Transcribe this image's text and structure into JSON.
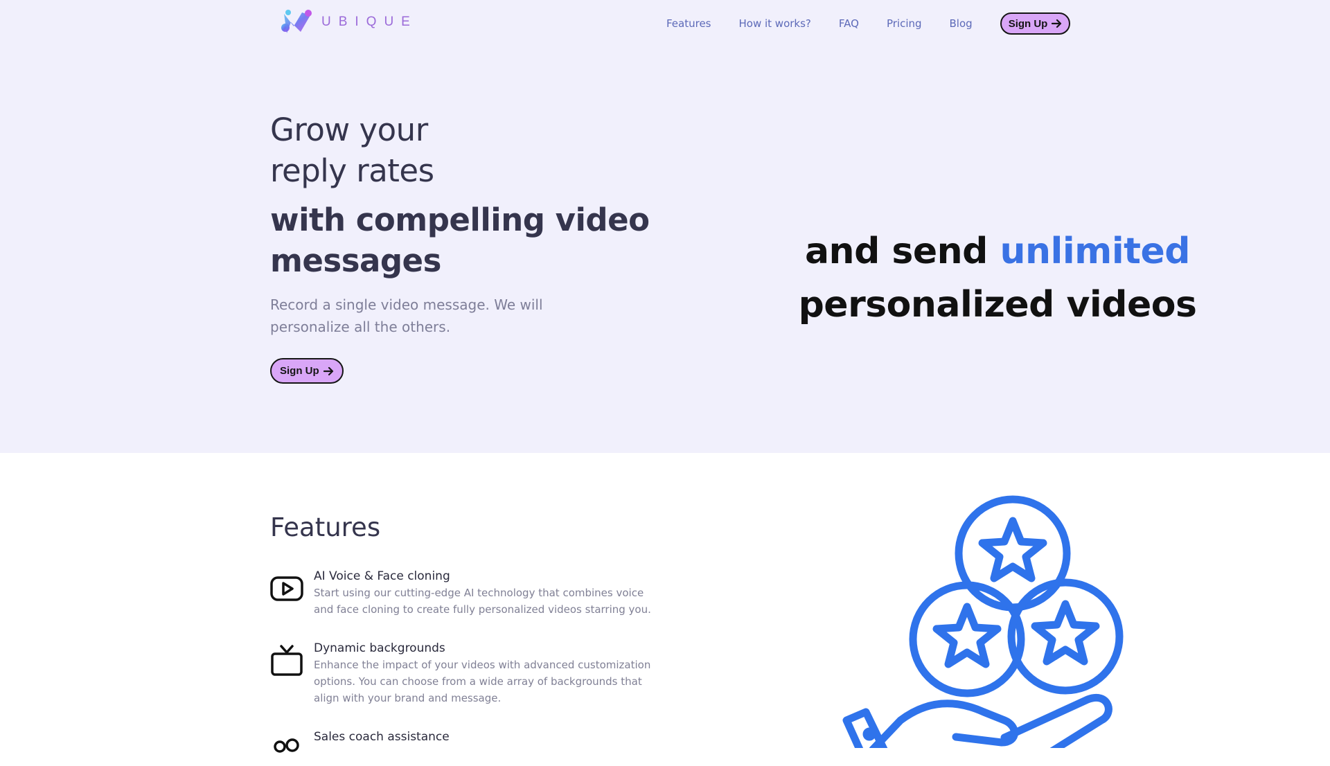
{
  "brand": {
    "name": "UBIQUE"
  },
  "nav": {
    "items": [
      "Features",
      "How it works?",
      "FAQ",
      "Pricing",
      "Blog"
    ],
    "signup_label": "Sign Up"
  },
  "hero": {
    "headline_line1": "Grow your",
    "headline_line2": "reply rates",
    "headline_rest": "with compelling video messages",
    "subtitle": "Record a single video message. We will personalize all the others.",
    "cta_label": "Sign Up",
    "tagline_before": "and send ",
    "tagline_highlight": "unlimited",
    "tagline_after": " personalized videos"
  },
  "features": {
    "title": "Features",
    "items": [
      {
        "icon": "youtube-play-icon",
        "title": "AI Voice & Face cloning",
        "description": "Start using our cutting-edge AI technology that combines voice and face cloning to create fully personalized videos starring you."
      },
      {
        "icon": "tv-icon",
        "title": "Dynamic backgrounds",
        "description": "Enhance the impact of your videos with advanced customization options. You can choose from a wide array of backgrounds that align with your brand and message."
      },
      {
        "icon": "users-icon",
        "title": "Sales coach assistance",
        "description": ""
      }
    ]
  },
  "colors": {
    "hero_bg": "#f1f0fc",
    "accent_blue": "#3a72e4",
    "button_bg": "#d9a6f7",
    "nav_link": "#5c69b8"
  }
}
